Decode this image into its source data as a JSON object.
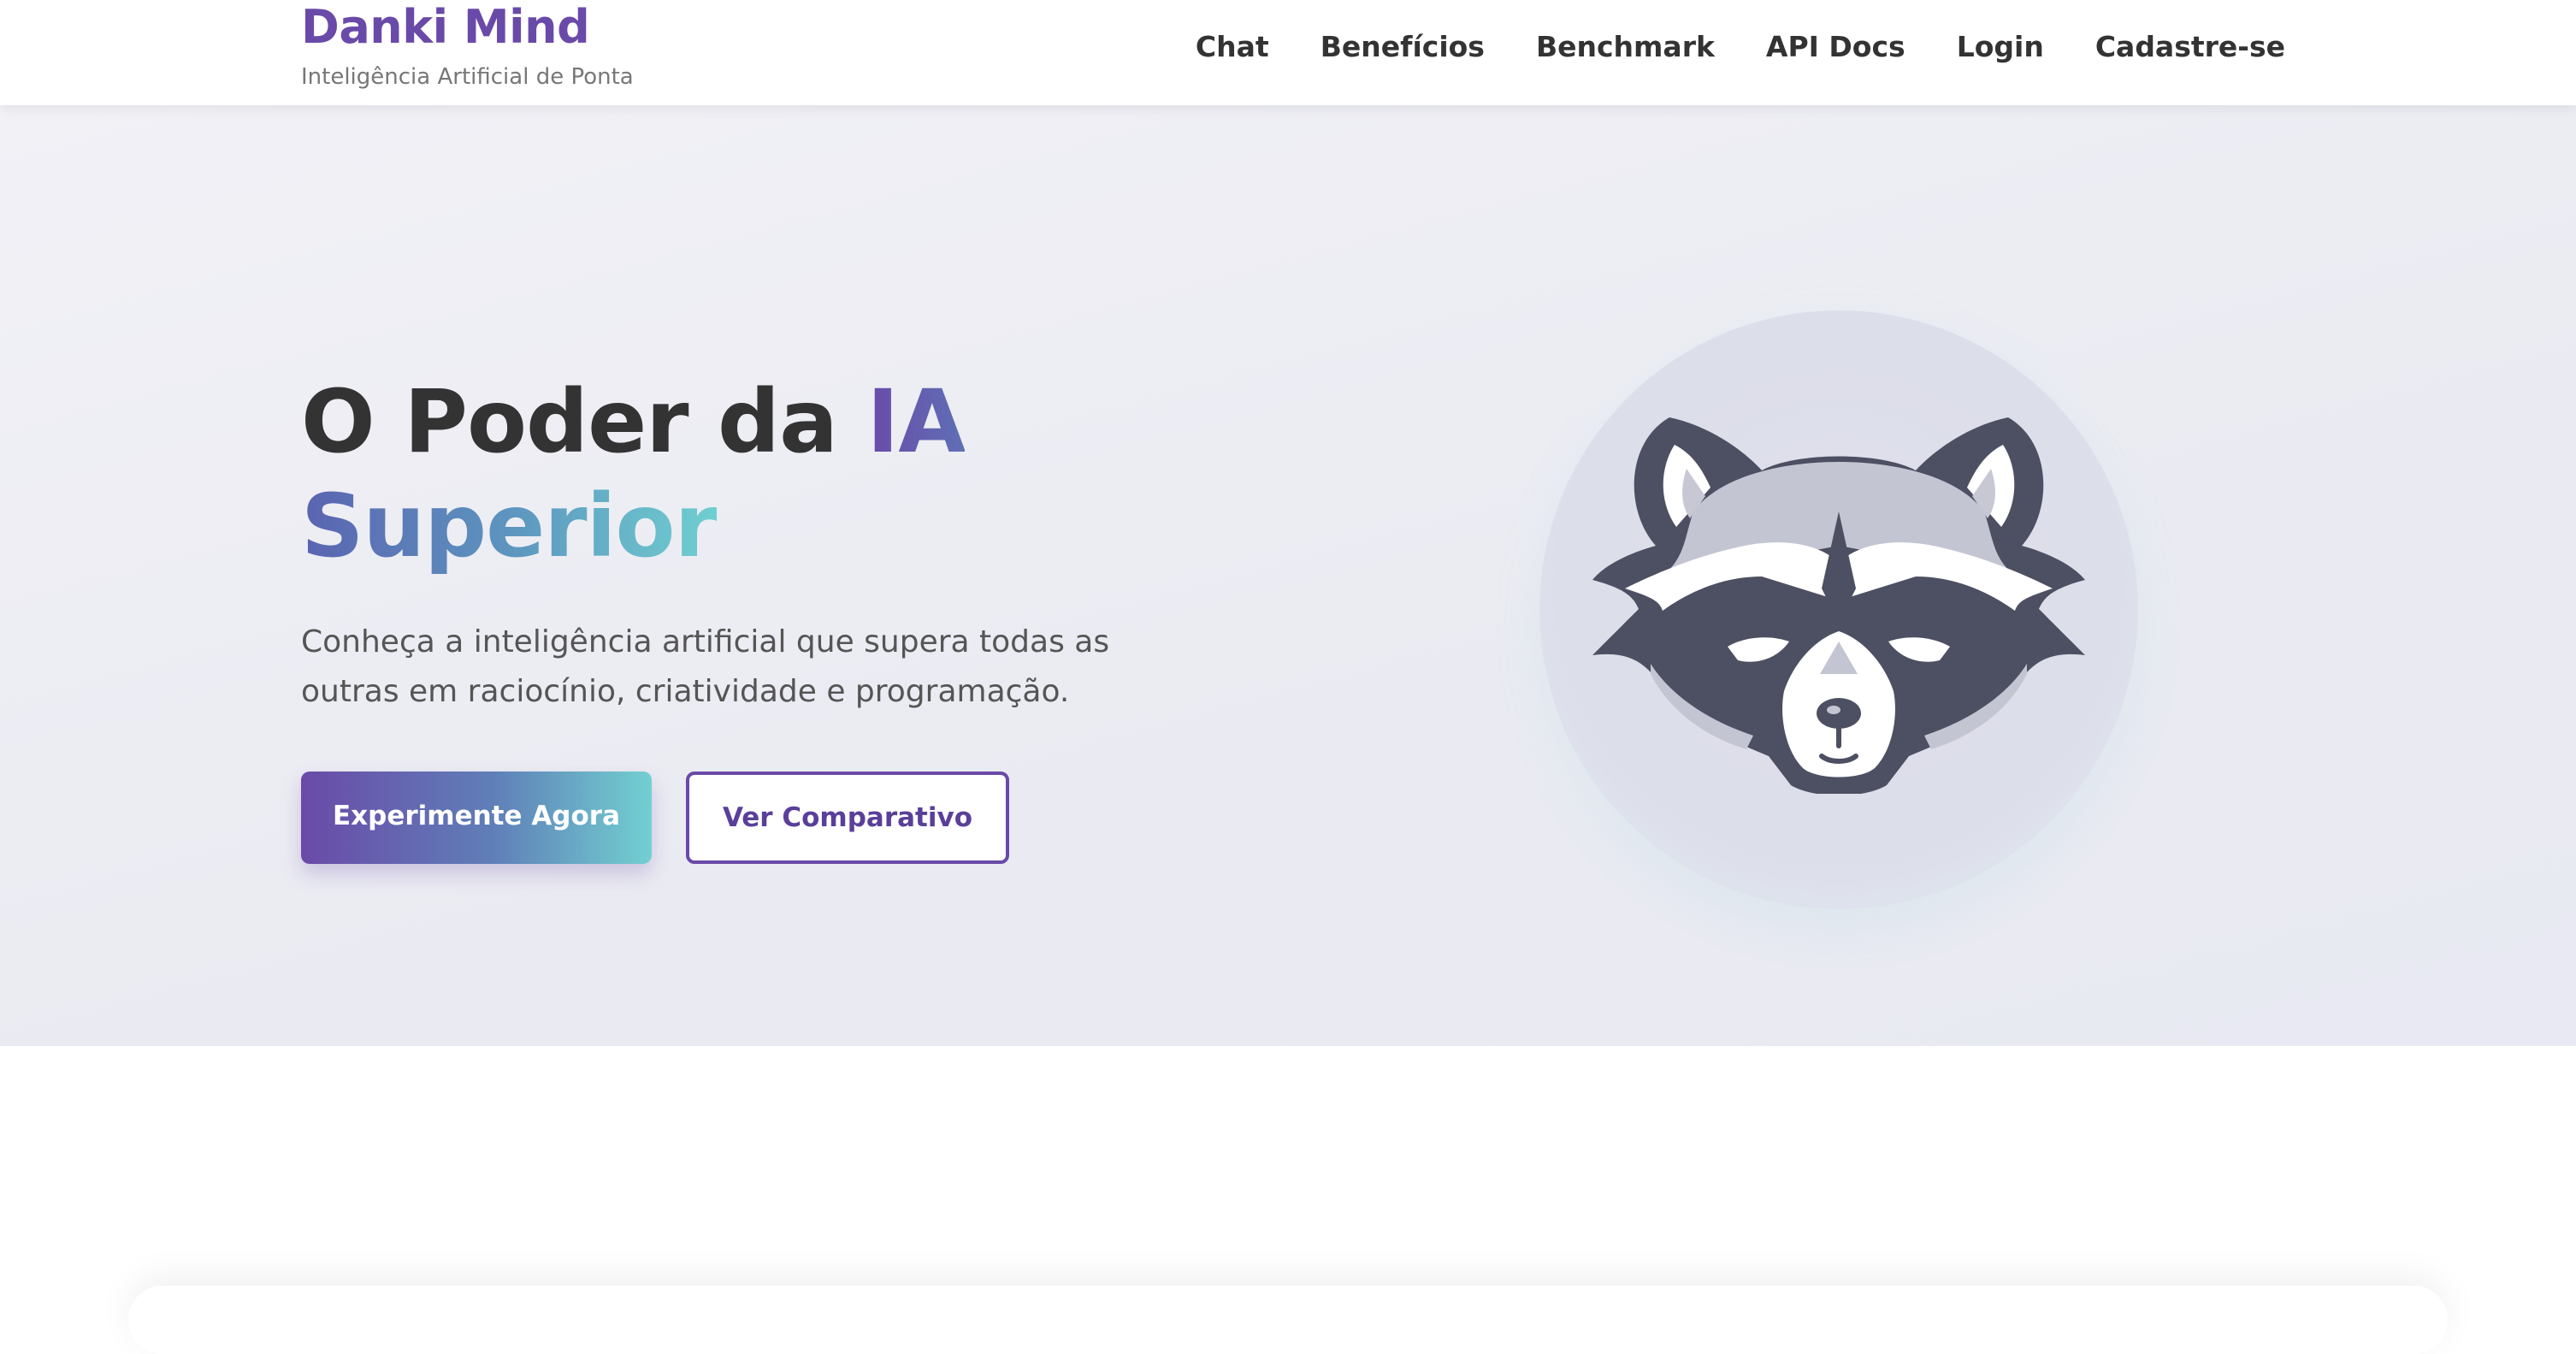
{
  "brand": {
    "name": "Danki Mind",
    "tagline": "Inteligência Artificial de Ponta"
  },
  "nav": {
    "items": [
      {
        "label": "Chat"
      },
      {
        "label": "Benefícios"
      },
      {
        "label": "Benchmark"
      },
      {
        "label": "API Docs"
      },
      {
        "label": "Login"
      },
      {
        "label": "Cadastre-se"
      }
    ]
  },
  "hero": {
    "title_part1": "O Poder da ",
    "title_accent": "IA",
    "title_line2": "Superior",
    "subtitle": "Conheça a inteligência artificial que supera todas as outras em raciocínio, criatividade e programação.",
    "primary_button": "Experimente Agora",
    "secondary_button": "Ver Comparativo",
    "mascot_icon": "raccoon-mascot-icon"
  },
  "colors": {
    "brand_purple": "#6a4aa8",
    "gradient_teal": "#72d0d1",
    "text_dark": "#333333",
    "hero_bg": "#eeeef4"
  }
}
